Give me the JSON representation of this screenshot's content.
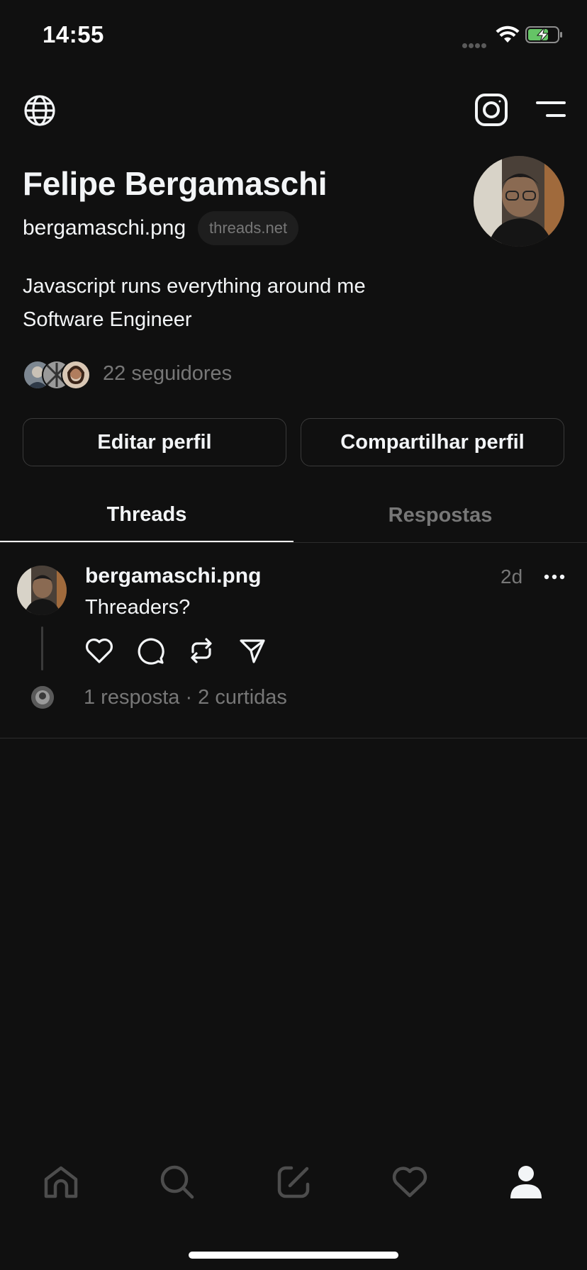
{
  "status_bar": {
    "time": "14:55",
    "icons": [
      "signal-dots-icon",
      "wifi-icon",
      "battery-charging-icon"
    ]
  },
  "top_nav": {
    "icons": [
      "globe-icon",
      "instagram-icon",
      "menu-icon"
    ]
  },
  "profile": {
    "name": "Felipe Bergamaschi",
    "handle": "bergamaschi.png",
    "domain": "threads.net",
    "bio": [
      "Javascript runs everything around me",
      "Software Engineer"
    ],
    "followers_text": "22 seguidores",
    "edit_button": "Editar perfil",
    "share_button": "Compartilhar perfil"
  },
  "tabs": [
    {
      "label": "Threads",
      "active": true
    },
    {
      "label": "Respostas",
      "active": false
    }
  ],
  "post": {
    "author": "bergamaschi.png",
    "time": "2d",
    "text": "Threaders?",
    "stats": "1 resposta · 2 curtidas",
    "actions": [
      "heart-icon",
      "comment-icon",
      "repost-icon",
      "send-icon"
    ]
  },
  "bottom_nav": {
    "items": [
      "home-icon",
      "search-icon",
      "compose-icon",
      "heart-icon",
      "profile-icon"
    ],
    "active": "profile-icon"
  },
  "colors": {
    "background": "#101010",
    "primary_text": "#f3f5f7",
    "secondary_text": "#777777",
    "border": "#2d2d2d",
    "battery_green": "#65c466"
  }
}
